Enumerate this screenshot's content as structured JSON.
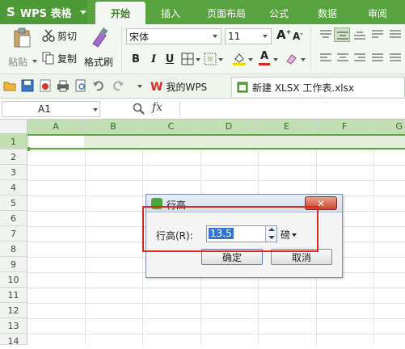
{
  "app": {
    "name": "WPS 表格",
    "logo_letter": "S",
    "tabs": [
      "开始",
      "插入",
      "页面布局",
      "公式",
      "数据",
      "审阅"
    ],
    "active_tab": "开始"
  },
  "ribbon": {
    "paste": "粘贴",
    "cut": "剪切",
    "copy": "复制",
    "format_painter": "格式刷",
    "font_name": "宋体",
    "font_size": "11",
    "bold": "B",
    "italic": "I",
    "underline": "U",
    "grow_font": "A",
    "shrink_font": "A"
  },
  "quickbar": {
    "doc_tabs": [
      {
        "label": "我的WPS"
      },
      {
        "label": "新建 XLSX 工作表.xlsx"
      }
    ]
  },
  "formula_bar": {
    "cell_ref": "A1",
    "fx": "fx",
    "formula": ""
  },
  "sheet": {
    "columns": [
      "A",
      "B",
      "C",
      "D",
      "E",
      "F",
      "G"
    ],
    "rows": [
      "1",
      "2",
      "3",
      "4",
      "5",
      "6",
      "7",
      "8",
      "9",
      "10",
      "11",
      "12",
      "13",
      "14"
    ],
    "selected_row": "1"
  },
  "dialog": {
    "title": "行高",
    "label": "行高(R):",
    "value": "13.5",
    "unit": "磅",
    "ok": "确定",
    "cancel": "取消"
  },
  "colors": {
    "brand_green": "#58a33f",
    "selection_green": "#5ea63d",
    "highlight_red": "#e0261b"
  }
}
